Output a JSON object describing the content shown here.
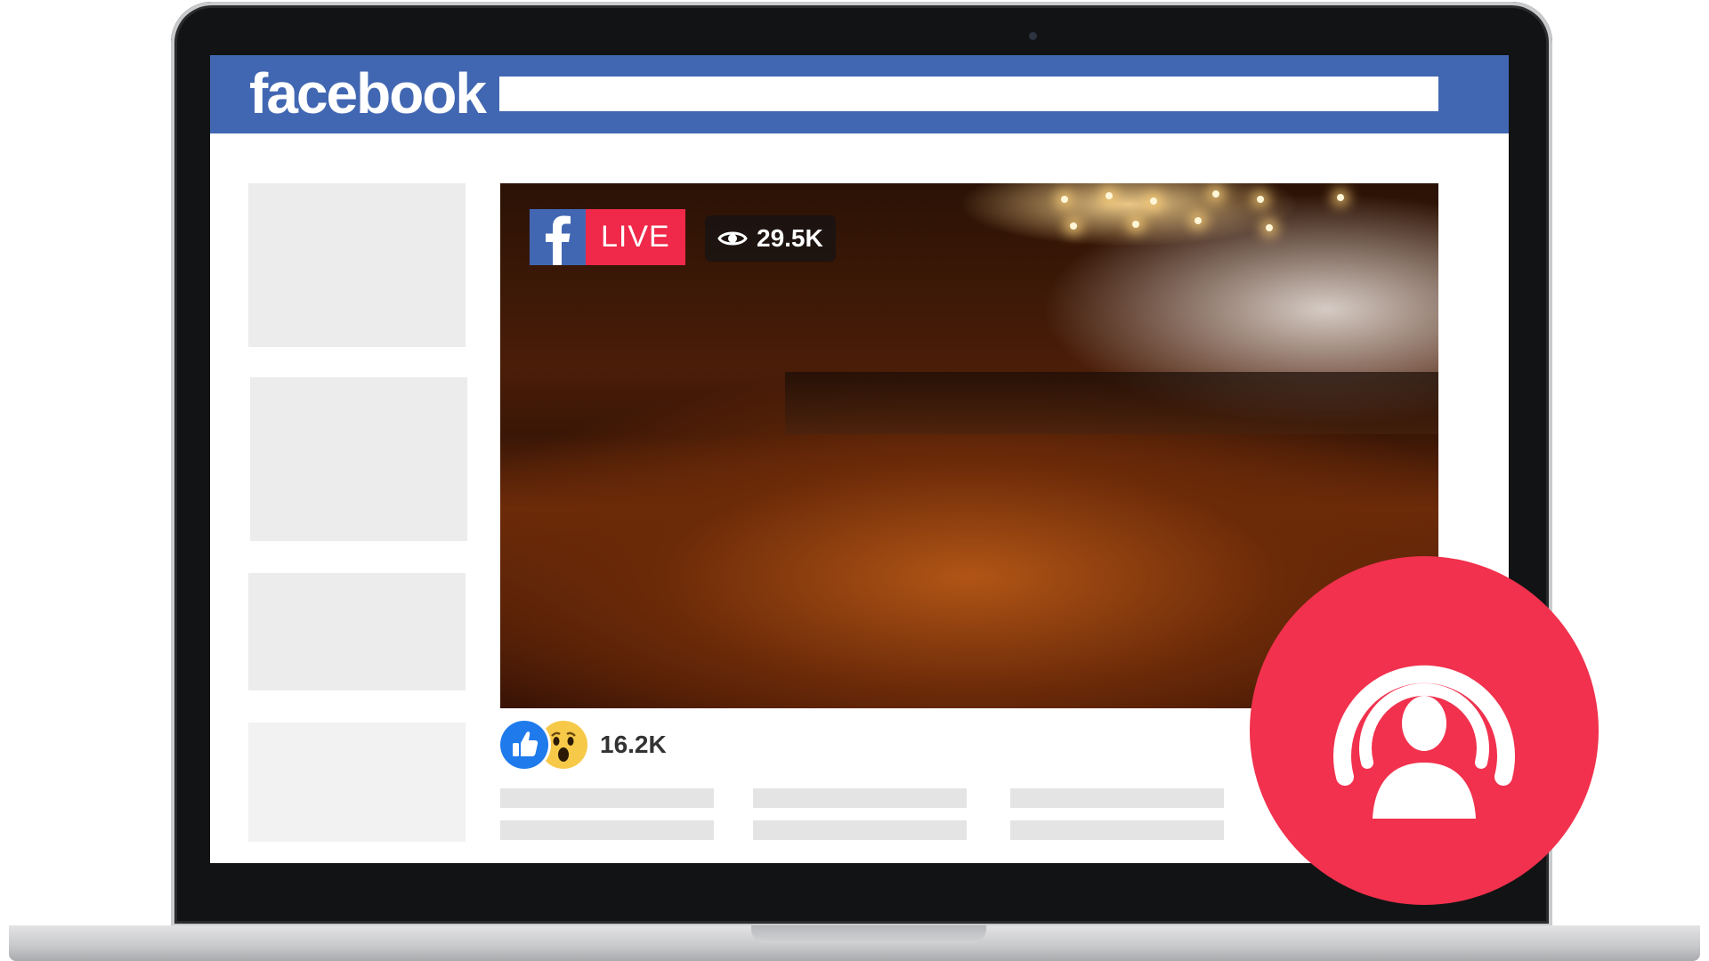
{
  "header": {
    "brand": "facebook",
    "search_placeholder": ""
  },
  "video": {
    "live_label": "LIVE",
    "viewer_count": "29.5K"
  },
  "reactions": {
    "count": "16.2K"
  },
  "icons": {
    "brand_badge": "facebook-f-icon",
    "viewers": "eye-icon",
    "like": "thumbs-up-icon",
    "wow": "wow-face-icon",
    "broadcast": "live-broadcast-icon"
  },
  "colors": {
    "facebook_blue": "#4267b2",
    "live_red": "#f02849",
    "broadcast_red": "#f1314d",
    "like_blue": "#1f7aec",
    "wow_yellow": "#f7c948"
  }
}
